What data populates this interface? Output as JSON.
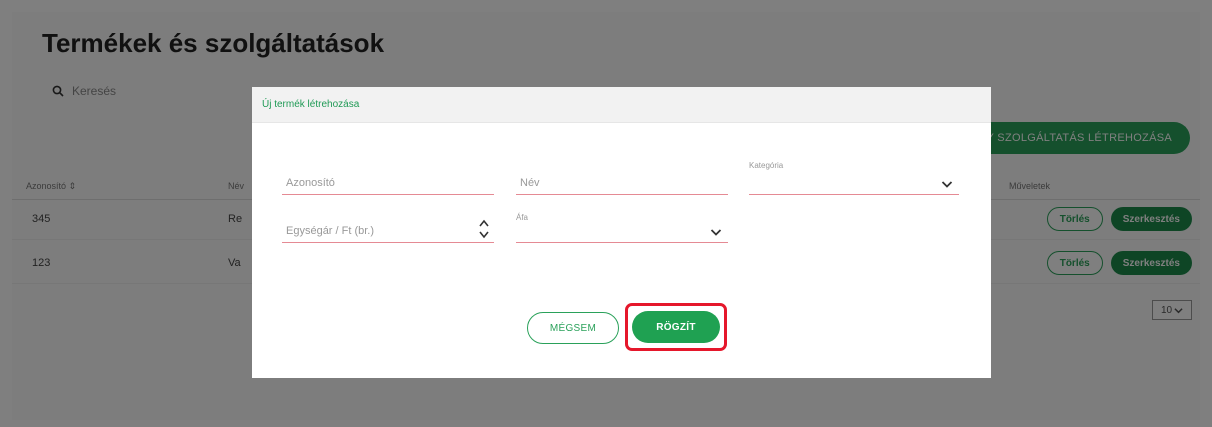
{
  "page": {
    "title": "Termékek és szolgáltatások",
    "search_placeholder": "Keresés",
    "create_button": "GY SZOLGÁLTATÁS LÉTREHOZÁSA",
    "columns": [
      "Azonosító ⇕",
      "Név",
      "Műveletek"
    ],
    "rows": [
      {
        "id": "345",
        "name": "Re",
        "delete": "Törlés",
        "edit": "Szerkesztés"
      },
      {
        "id": "123",
        "name": "Va",
        "delete": "Törlés",
        "edit": "Szerkesztés"
      }
    ],
    "page_size": "10"
  },
  "modal": {
    "title": "Új termék létrehozása",
    "fields": {
      "id_placeholder": "Azonosító",
      "name_placeholder": "Név",
      "category_label": "Kategória",
      "unit_price_placeholder": "Egységár / Ft (br.)",
      "vat_label": "Áfa"
    },
    "cancel_label": "MÉGSEM",
    "save_label": "RÖGZÍT"
  },
  "colors": {
    "accent": "#1fa152",
    "highlight": "#e5172b",
    "field_line": "#e58a94"
  }
}
